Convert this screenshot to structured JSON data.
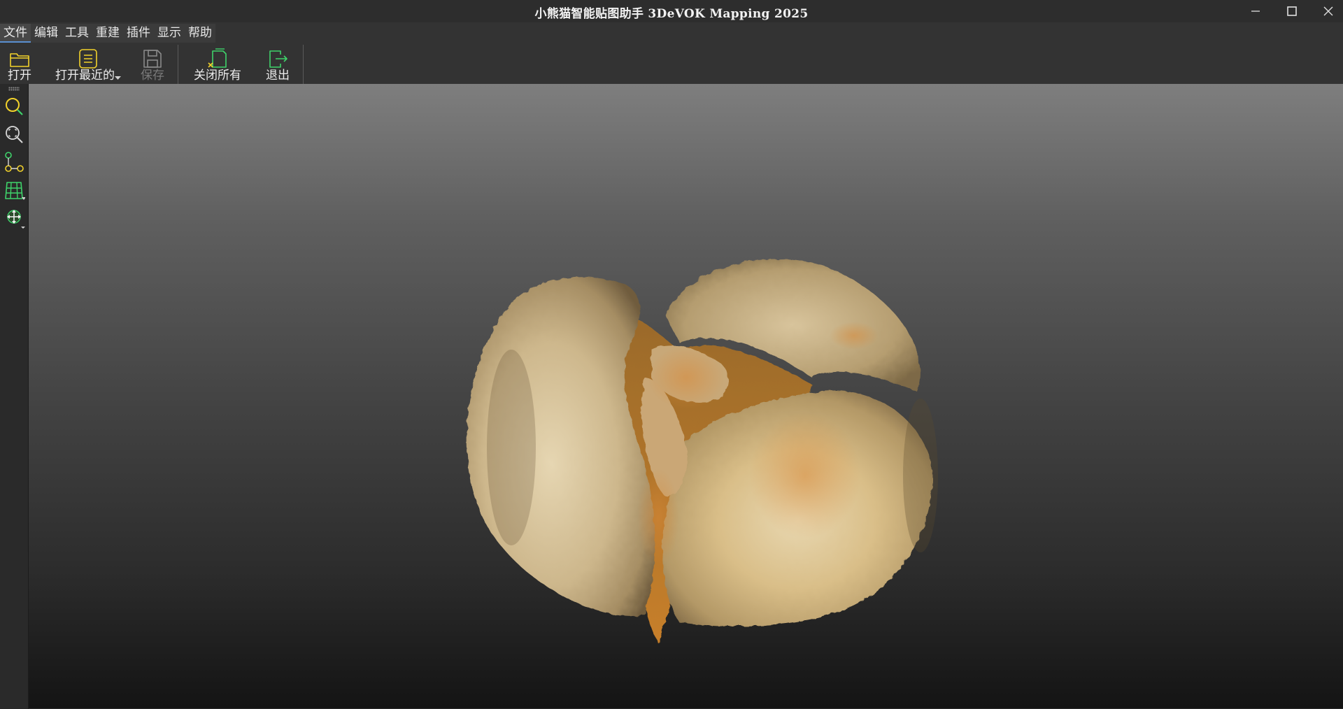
{
  "window": {
    "title": "小熊猫智能贴图助手 3DeVOK Mapping 2025",
    "controls": [
      "minimize-icon",
      "maximize-icon",
      "close-icon"
    ]
  },
  "menu": {
    "items": [
      {
        "label": "文件",
        "active": true
      },
      {
        "label": "编辑"
      },
      {
        "label": "工具"
      },
      {
        "label": "重建"
      },
      {
        "label": "插件"
      },
      {
        "label": "显示"
      },
      {
        "label": "帮助"
      }
    ]
  },
  "toolbar": {
    "open": {
      "label": "打开",
      "icon": "folder-open-icon"
    },
    "open_recent": {
      "label": "打开最近的",
      "icon": "recent-files-icon"
    },
    "save": {
      "label": "保存",
      "icon": "save-icon",
      "disabled": true
    },
    "close_all": {
      "label": "关闭所有",
      "icon": "close-all-icon"
    },
    "exit": {
      "label": "退出",
      "icon": "exit-icon"
    }
  },
  "left_tools": [
    {
      "icon": "zoom-icon"
    },
    {
      "icon": "zoom-fit-icon"
    },
    {
      "icon": "point-connect-icon"
    },
    {
      "icon": "mesh-grid-icon",
      "has_menu": true
    },
    {
      "icon": "move-icon",
      "has_menu": true
    }
  ],
  "viewport": {
    "content": "3D textured model",
    "colors": {
      "top": "#7e7e7e",
      "bottom": "#141414"
    }
  },
  "colors": {
    "accent_green": "#3ed36a",
    "accent_yellow": "#f2d22b",
    "accent_blue": "#5a8fd0"
  }
}
